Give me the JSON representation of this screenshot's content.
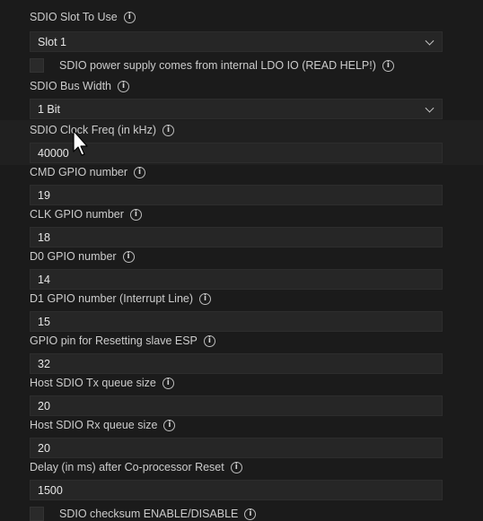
{
  "settings": {
    "slot": {
      "label": "SDIO Slot To Use",
      "value": "Slot 1"
    },
    "ldo": {
      "label": "SDIO power supply comes from internal LDO IO (READ HELP!)"
    },
    "bus_width": {
      "label": "SDIO Bus Width",
      "value": "1 Bit"
    },
    "clock": {
      "label": "SDIO Clock Freq (in kHz)",
      "value": "40000"
    },
    "cmd": {
      "label": "CMD GPIO number",
      "value": "19"
    },
    "clk": {
      "label": "CLK GPIO number",
      "value": "18"
    },
    "d0": {
      "label": "D0 GPIO number",
      "value": "14"
    },
    "d1": {
      "label": "D1 GPIO number (Interrupt Line)",
      "value": "15"
    },
    "reset": {
      "label": "GPIO pin for Resetting slave ESP",
      "value": "32"
    },
    "tx": {
      "label": "Host SDIO Tx queue size",
      "value": "20"
    },
    "rx": {
      "label": "Host SDIO Rx queue size",
      "value": "20"
    },
    "delay": {
      "label": "Delay (in ms) after Co-processor Reset",
      "value": "1500"
    },
    "checksum": {
      "label": "SDIO checksum ENABLE/DISABLE"
    }
  },
  "info_icon_glyph": "i"
}
